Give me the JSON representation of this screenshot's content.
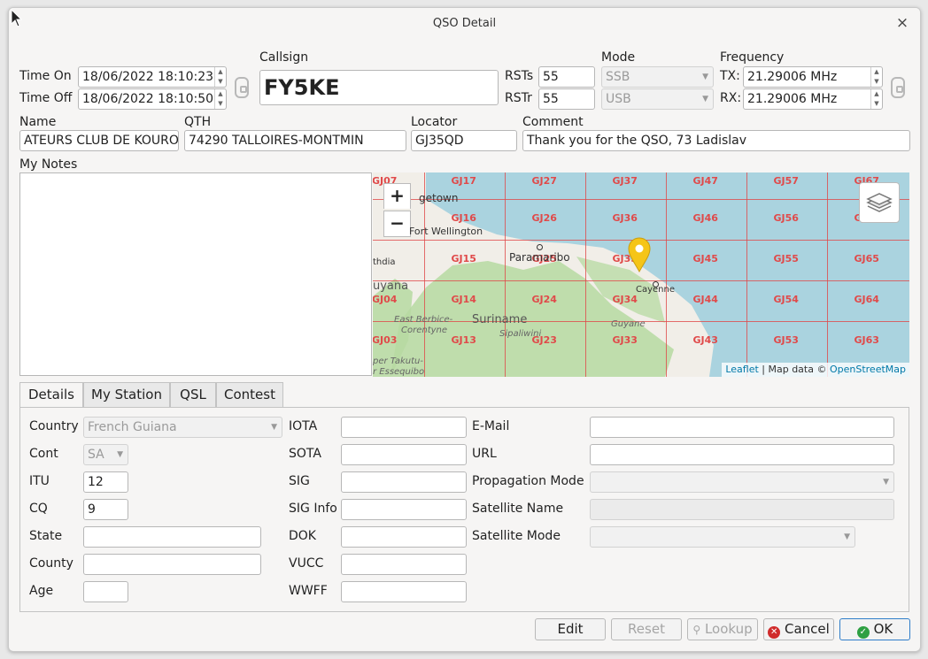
{
  "window": {
    "title": "QSO Detail",
    "close_glyph": "×"
  },
  "header": {
    "time_on_label": "Time On",
    "time_on": "18/06/2022 18:10:23",
    "time_off_label": "Time Off",
    "time_off": "18/06/2022 18:10:50",
    "callsign_label": "Callsign",
    "callsign": "FY5KE",
    "rsts_label": "RSTs",
    "rsts": "55",
    "rstr_label": "RSTr",
    "rstr": "55",
    "mode_label": "Mode",
    "mode_tx": "SSB",
    "mode_rx": "USB",
    "frequency_label": "Frequency",
    "tx_label": "TX:",
    "tx_freq": "21.29006 MHz",
    "rx_label": "RX:",
    "rx_freq": "21.29006 MHz",
    "name_label": "Name",
    "name": "ATEURS CLUB DE KOUROU",
    "qth_label": "QTH",
    "qth": "74290 TALLOIRES-MONTMIN",
    "locator_label": "Locator",
    "locator": "GJ35QD",
    "comment_label": "Comment",
    "comment": "Thank you for the QSO, 73 Ladislav",
    "notes_label": "My Notes"
  },
  "map": {
    "zoom_in": "+",
    "zoom_out": "−",
    "grid_labels": [
      "GJ07",
      "GJ17",
      "GJ27",
      "GJ37",
      "GJ47",
      "GJ57",
      "GJ67",
      "GJ16",
      "GJ26",
      "GJ36",
      "GJ46",
      "GJ56",
      "GJ66",
      "GJ15",
      "GJ25",
      "GJ35",
      "GJ45",
      "GJ55",
      "GJ65",
      "GJ04",
      "GJ14",
      "GJ24",
      "GJ34",
      "GJ44",
      "GJ54",
      "GJ64",
      "GJ03",
      "GJ13",
      "GJ23",
      "GJ33",
      "GJ43",
      "GJ53",
      "GJ63"
    ],
    "places": {
      "georgetown": "getown",
      "fort_wellington": "Fort Wellington",
      "paramaribo": "Paramaribo",
      "cayenne": "Cayenne",
      "suriname": "Suriname",
      "guyana": "uyana",
      "lethem": "thdia",
      "east_berbice": "East Berbice-",
      "corentyne": "Corentyne",
      "sipaliwini": "Sipaliwini",
      "guyane": "Guyane",
      "upper_takutu": "per Takutu-",
      "essequibo": "r Essequibo"
    },
    "attribution_leaflet": "Leaflet",
    "attribution_text": " | Map data © ",
    "attribution_osm": "OpenStreetMap",
    "marker_color": "#f5c518"
  },
  "tabs": [
    {
      "label": "Details",
      "active": true
    },
    {
      "label": "My Station",
      "active": false
    },
    {
      "label": "QSL",
      "active": false
    },
    {
      "label": "Contest",
      "active": false
    }
  ],
  "details": {
    "country_label": "Country",
    "country": "French Guiana",
    "cont_label": "Cont",
    "cont": "SA",
    "itu_label": "ITU",
    "itu": "12",
    "cq_label": "CQ",
    "cq": "9",
    "state_label": "State",
    "state": "",
    "county_label": "County",
    "county": "",
    "age_label": "Age",
    "age": "",
    "iota_label": "IOTA",
    "iota": "",
    "sota_label": "SOTA",
    "sota": "",
    "sig_label": "SIG",
    "sig": "",
    "sig_info_label": "SIG Info",
    "sig_info": "",
    "dok_label": "DOK",
    "dok": "",
    "vucc_label": "VUCC",
    "vucc": "",
    "wwff_label": "WWFF",
    "wwff": "",
    "email_label": "E-Mail",
    "email": "",
    "url_label": "URL",
    "url": "",
    "prop_mode_label": "Propagation Mode",
    "prop_mode": "",
    "sat_name_label": "Satellite Name",
    "sat_name": "",
    "sat_mode_label": "Satellite Mode",
    "sat_mode": ""
  },
  "buttons": {
    "edit": "Edit",
    "reset": "Reset",
    "lookup": "Lookup",
    "cancel": "Cancel",
    "ok": "OK"
  },
  "colors": {
    "accent": "#2f7dc9",
    "grid_line": "#e04a4a",
    "water": "#aad3df",
    "land": "#f1eee8",
    "forest": "#b6d9a1",
    "cancel_icon": "#d02b2b",
    "ok_icon": "#2ea043"
  }
}
